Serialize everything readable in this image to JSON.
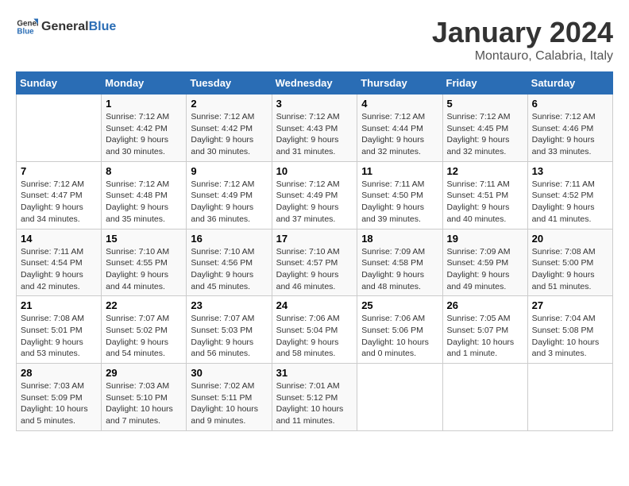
{
  "header": {
    "logo_general": "General",
    "logo_blue": "Blue",
    "month_title": "January 2024",
    "location": "Montauro, Calabria, Italy"
  },
  "days_of_week": [
    "Sunday",
    "Monday",
    "Tuesday",
    "Wednesday",
    "Thursday",
    "Friday",
    "Saturday"
  ],
  "weeks": [
    [
      {
        "day": "",
        "sunrise": "",
        "sunset": "",
        "daylight": ""
      },
      {
        "day": "1",
        "sunrise": "Sunrise: 7:12 AM",
        "sunset": "Sunset: 4:42 PM",
        "daylight": "Daylight: 9 hours and 30 minutes."
      },
      {
        "day": "2",
        "sunrise": "Sunrise: 7:12 AM",
        "sunset": "Sunset: 4:42 PM",
        "daylight": "Daylight: 9 hours and 30 minutes."
      },
      {
        "day": "3",
        "sunrise": "Sunrise: 7:12 AM",
        "sunset": "Sunset: 4:43 PM",
        "daylight": "Daylight: 9 hours and 31 minutes."
      },
      {
        "day": "4",
        "sunrise": "Sunrise: 7:12 AM",
        "sunset": "Sunset: 4:44 PM",
        "daylight": "Daylight: 9 hours and 32 minutes."
      },
      {
        "day": "5",
        "sunrise": "Sunrise: 7:12 AM",
        "sunset": "Sunset: 4:45 PM",
        "daylight": "Daylight: 9 hours and 32 minutes."
      },
      {
        "day": "6",
        "sunrise": "Sunrise: 7:12 AM",
        "sunset": "Sunset: 4:46 PM",
        "daylight": "Daylight: 9 hours and 33 minutes."
      }
    ],
    [
      {
        "day": "7",
        "sunrise": "Sunrise: 7:12 AM",
        "sunset": "Sunset: 4:47 PM",
        "daylight": "Daylight: 9 hours and 34 minutes."
      },
      {
        "day": "8",
        "sunrise": "Sunrise: 7:12 AM",
        "sunset": "Sunset: 4:48 PM",
        "daylight": "Daylight: 9 hours and 35 minutes."
      },
      {
        "day": "9",
        "sunrise": "Sunrise: 7:12 AM",
        "sunset": "Sunset: 4:49 PM",
        "daylight": "Daylight: 9 hours and 36 minutes."
      },
      {
        "day": "10",
        "sunrise": "Sunrise: 7:12 AM",
        "sunset": "Sunset: 4:49 PM",
        "daylight": "Daylight: 9 hours and 37 minutes."
      },
      {
        "day": "11",
        "sunrise": "Sunrise: 7:11 AM",
        "sunset": "Sunset: 4:50 PM",
        "daylight": "Daylight: 9 hours and 39 minutes."
      },
      {
        "day": "12",
        "sunrise": "Sunrise: 7:11 AM",
        "sunset": "Sunset: 4:51 PM",
        "daylight": "Daylight: 9 hours and 40 minutes."
      },
      {
        "day": "13",
        "sunrise": "Sunrise: 7:11 AM",
        "sunset": "Sunset: 4:52 PM",
        "daylight": "Daylight: 9 hours and 41 minutes."
      }
    ],
    [
      {
        "day": "14",
        "sunrise": "Sunrise: 7:11 AM",
        "sunset": "Sunset: 4:54 PM",
        "daylight": "Daylight: 9 hours and 42 minutes."
      },
      {
        "day": "15",
        "sunrise": "Sunrise: 7:10 AM",
        "sunset": "Sunset: 4:55 PM",
        "daylight": "Daylight: 9 hours and 44 minutes."
      },
      {
        "day": "16",
        "sunrise": "Sunrise: 7:10 AM",
        "sunset": "Sunset: 4:56 PM",
        "daylight": "Daylight: 9 hours and 45 minutes."
      },
      {
        "day": "17",
        "sunrise": "Sunrise: 7:10 AM",
        "sunset": "Sunset: 4:57 PM",
        "daylight": "Daylight: 9 hours and 46 minutes."
      },
      {
        "day": "18",
        "sunrise": "Sunrise: 7:09 AM",
        "sunset": "Sunset: 4:58 PM",
        "daylight": "Daylight: 9 hours and 48 minutes."
      },
      {
        "day": "19",
        "sunrise": "Sunrise: 7:09 AM",
        "sunset": "Sunset: 4:59 PM",
        "daylight": "Daylight: 9 hours and 49 minutes."
      },
      {
        "day": "20",
        "sunrise": "Sunrise: 7:08 AM",
        "sunset": "Sunset: 5:00 PM",
        "daylight": "Daylight: 9 hours and 51 minutes."
      }
    ],
    [
      {
        "day": "21",
        "sunrise": "Sunrise: 7:08 AM",
        "sunset": "Sunset: 5:01 PM",
        "daylight": "Daylight: 9 hours and 53 minutes."
      },
      {
        "day": "22",
        "sunrise": "Sunrise: 7:07 AM",
        "sunset": "Sunset: 5:02 PM",
        "daylight": "Daylight: 9 hours and 54 minutes."
      },
      {
        "day": "23",
        "sunrise": "Sunrise: 7:07 AM",
        "sunset": "Sunset: 5:03 PM",
        "daylight": "Daylight: 9 hours and 56 minutes."
      },
      {
        "day": "24",
        "sunrise": "Sunrise: 7:06 AM",
        "sunset": "Sunset: 5:04 PM",
        "daylight": "Daylight: 9 hours and 58 minutes."
      },
      {
        "day": "25",
        "sunrise": "Sunrise: 7:06 AM",
        "sunset": "Sunset: 5:06 PM",
        "daylight": "Daylight: 10 hours and 0 minutes."
      },
      {
        "day": "26",
        "sunrise": "Sunrise: 7:05 AM",
        "sunset": "Sunset: 5:07 PM",
        "daylight": "Daylight: 10 hours and 1 minute."
      },
      {
        "day": "27",
        "sunrise": "Sunrise: 7:04 AM",
        "sunset": "Sunset: 5:08 PM",
        "daylight": "Daylight: 10 hours and 3 minutes."
      }
    ],
    [
      {
        "day": "28",
        "sunrise": "Sunrise: 7:03 AM",
        "sunset": "Sunset: 5:09 PM",
        "daylight": "Daylight: 10 hours and 5 minutes."
      },
      {
        "day": "29",
        "sunrise": "Sunrise: 7:03 AM",
        "sunset": "Sunset: 5:10 PM",
        "daylight": "Daylight: 10 hours and 7 minutes."
      },
      {
        "day": "30",
        "sunrise": "Sunrise: 7:02 AM",
        "sunset": "Sunset: 5:11 PM",
        "daylight": "Daylight: 10 hours and 9 minutes."
      },
      {
        "day": "31",
        "sunrise": "Sunrise: 7:01 AM",
        "sunset": "Sunset: 5:12 PM",
        "daylight": "Daylight: 10 hours and 11 minutes."
      },
      {
        "day": "",
        "sunrise": "",
        "sunset": "",
        "daylight": ""
      },
      {
        "day": "",
        "sunrise": "",
        "sunset": "",
        "daylight": ""
      },
      {
        "day": "",
        "sunrise": "",
        "sunset": "",
        "daylight": ""
      }
    ]
  ]
}
